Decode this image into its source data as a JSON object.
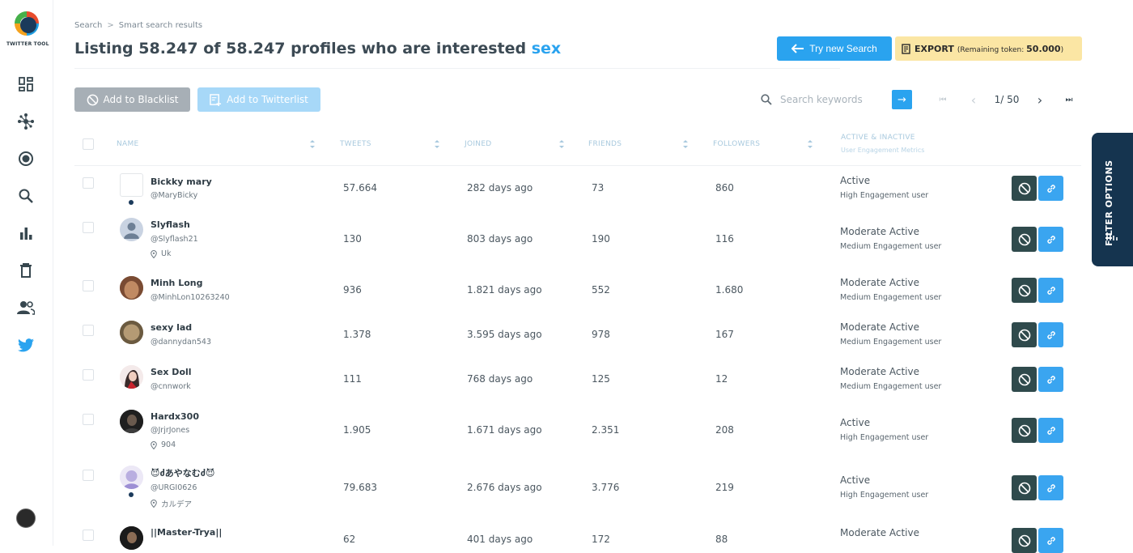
{
  "app": {
    "logo_text": "TWITTER TOOL"
  },
  "sidebar": {
    "items": [
      {
        "icon": "dashboard-icon"
      },
      {
        "icon": "network-icon"
      },
      {
        "icon": "target-icon"
      },
      {
        "icon": "search-icon"
      },
      {
        "icon": "bar-chart-icon"
      },
      {
        "icon": "trash-icon"
      },
      {
        "icon": "users-icon"
      },
      {
        "icon": "twitter-bird-icon"
      }
    ]
  },
  "breadcrumb": {
    "root": "Search",
    "separator": ">",
    "current": "Smart search results"
  },
  "header": {
    "title_prefix": "Listing 58.247 of 58.247 profiles who are interested",
    "keyword": "sex",
    "try_new_search": "Try new Search",
    "export_label": "EXPORT",
    "export_note_prefix": "(Remaining token:",
    "export_tokens": "50.000",
    "export_note_suffix": ")"
  },
  "actions": {
    "add_blacklist": "Add to Blacklist",
    "add_twitterlist": "Add to Twitterlist"
  },
  "search": {
    "placeholder": "Search keywords",
    "go": "→"
  },
  "pagination": {
    "first": "⏮",
    "prev": "‹",
    "page_text": "1/ 50",
    "next": "›",
    "last": "⏭"
  },
  "table": {
    "columns": {
      "name": "NAME",
      "tweets": "TWEETS",
      "joined": "JOINED",
      "friends": "FRIENDS",
      "followers": "FOLLOWERS",
      "activity": "ACTIVE & INACTIVE",
      "activity_sub": "User Engagement Metrics"
    },
    "rows": [
      {
        "name": "Bickky mary",
        "handle": "@MaryBicky",
        "location": "",
        "tweets": "57.664",
        "joined": "282 days ago",
        "friends": "73",
        "followers": "860",
        "status": "Active",
        "engagement": "High Engagement user"
      },
      {
        "name": "Slyflash",
        "handle": "@Slyflash21",
        "location": "Uk",
        "tweets": "130",
        "joined": "803 days ago",
        "friends": "190",
        "followers": "116",
        "status": "Moderate Active",
        "engagement": "Medium Engagement user"
      },
      {
        "name": "Minh Long",
        "handle": "@MinhLon10263240",
        "location": "",
        "tweets": "936",
        "joined": "1.821 days ago",
        "friends": "552",
        "followers": "1.680",
        "status": "Moderate Active",
        "engagement": "Medium Engagement user"
      },
      {
        "name": "sexy lad",
        "handle": "@dannydan543",
        "location": "",
        "tweets": "1.378",
        "joined": "3.595 days ago",
        "friends": "978",
        "followers": "167",
        "status": "Moderate Active",
        "engagement": "Medium Engagement user"
      },
      {
        "name": "Sex Doll",
        "handle": "@cnnwork",
        "location": "",
        "tweets": "111",
        "joined": "768 days ago",
        "friends": "125",
        "followers": "12",
        "status": "Moderate Active",
        "engagement": "Medium Engagement user"
      },
      {
        "name": "Hardx300",
        "handle": "@JrjrJones",
        "location": "904",
        "tweets": "1.905",
        "joined": "1.671 days ago",
        "friends": "2.351",
        "followers": "208",
        "status": "Active",
        "engagement": "High Engagement user"
      },
      {
        "name": "😈ძあやなむძ😈",
        "handle": "@URGI0626",
        "location": "カルデア",
        "tweets": "79.683",
        "joined": "2.676 days ago",
        "friends": "3.776",
        "followers": "219",
        "status": "Active",
        "engagement": "High Engagement user"
      },
      {
        "name": "||Master-Trya||",
        "handle": "",
        "location": "",
        "tweets": "62",
        "joined": "401 days ago",
        "friends": "172",
        "followers": "88",
        "status": "Moderate Active",
        "engagement": ""
      }
    ]
  },
  "filter_tab": {
    "label": "FILTER OPTIONS"
  },
  "colors": {
    "accent": "#2aa3ef",
    "export_bg": "#fbe6a4",
    "block_btn": "#2f4a4c",
    "filter_bg": "#15344f"
  }
}
